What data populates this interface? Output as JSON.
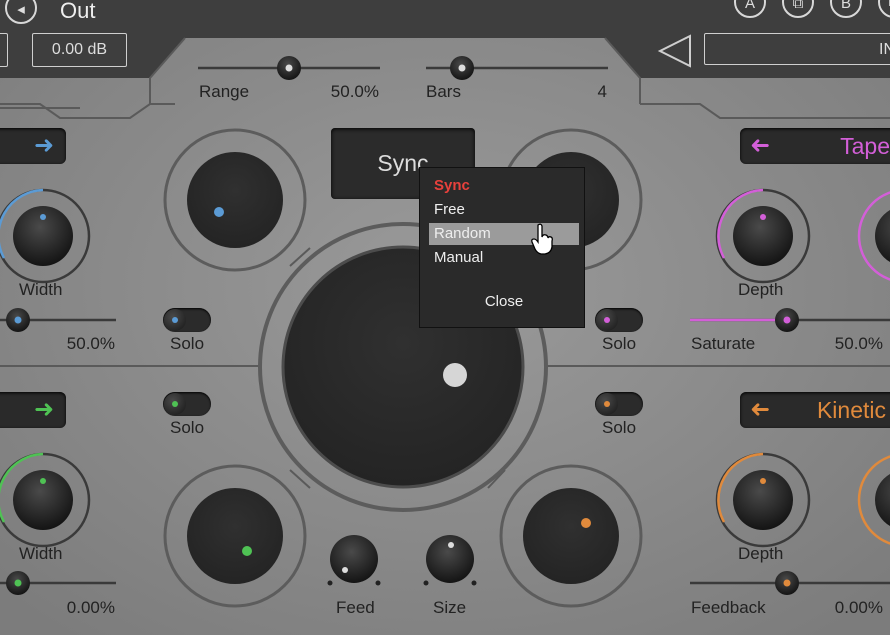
{
  "header": {
    "title": "Out",
    "back_icon": "back-arrow-icon",
    "output_gain": "0.00 dB",
    "input_label": "IN",
    "buttons": [
      "A",
      "",
      "B",
      ""
    ]
  },
  "top_sliders": {
    "range": {
      "label": "Range",
      "value": "50.0%",
      "fraction": 0.5
    },
    "bars": {
      "label": "Bars",
      "value": "4"
    }
  },
  "sync": {
    "button_label": "Sync",
    "menu": {
      "header": "Sync",
      "items": [
        "Free",
        "Random",
        "Manual"
      ],
      "highlighted": "Random",
      "close_label": "Close"
    }
  },
  "modules": {
    "top_left": {
      "arrow": "arrow-right-icon",
      "knob_label": "Width",
      "slider_value": "50.0%",
      "solo_label": "Solo",
      "color": "#5b9bd5"
    },
    "top_right": {
      "name": "Tape",
      "arrow": "arrow-left-icon",
      "knob_label": "Depth",
      "slider_label": "Saturate",
      "slider_value": "50.0%",
      "solo_label": "Solo",
      "color": "#d35fd8"
    },
    "bottom_left": {
      "arrow": "arrow-right-icon",
      "knob_label": "Width",
      "slider_value": "0.00%",
      "solo_label": "Solo",
      "color": "#4fc254"
    },
    "bottom_right": {
      "name": "Kinetic",
      "arrow": "arrow-left-icon",
      "knob_label": "Depth",
      "slider_label": "Feedback",
      "slider_value": "0.00%",
      "solo_label": "Solo",
      "color": "#e08a3c"
    }
  },
  "center": {
    "feed_label": "Feed",
    "size_label": "Size"
  },
  "colors": {
    "sync_header": "#e8413c",
    "panel": "#8e8e8e"
  }
}
